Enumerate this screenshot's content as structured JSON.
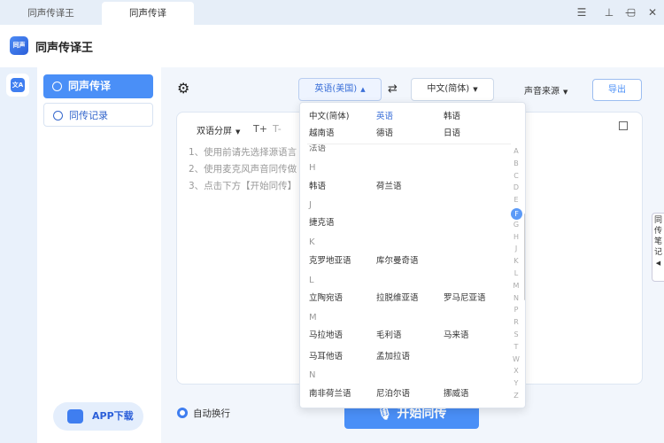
{
  "tabs": [
    "同声传译王",
    "同声传译"
  ],
  "header": {
    "title": "同声传译王",
    "logo_text": "同声"
  },
  "rail": {
    "icon_text": "文A"
  },
  "sidebar": {
    "items": [
      {
        "label": "同声传译"
      },
      {
        "label": "同传记录"
      }
    ],
    "app_download": "APP下载"
  },
  "toolbar": {
    "source_lang": "英语(美国)",
    "target_lang": "中文(简体)",
    "voice_source": "声音来源",
    "export": "导出"
  },
  "card": {
    "mode": "双语分屏",
    "tips": [
      "1、使用前请先选择源语言",
      "2、使用麦克风声音同传做",
      "3、点击下方【开始同传】"
    ],
    "font_up": "T+",
    "font_down": "T-"
  },
  "auto_wrap": "自动换行",
  "start_button": "开始同传",
  "side_tab": "同传笔记",
  "dropdown": {
    "recent_row1": [
      "中文(简体)",
      "英语",
      "韩语"
    ],
    "recent_row2": [
      "越南语",
      "德语",
      "日语"
    ],
    "partial": "法语",
    "groups": [
      {
        "letter": "H",
        "langs": [
          "韩语",
          "荷兰语"
        ]
      },
      {
        "letter": "J",
        "langs": [
          "捷克语"
        ]
      },
      {
        "letter": "K",
        "langs": [
          "克罗地亚语",
          "库尔曼奇语"
        ]
      },
      {
        "letter": "L",
        "langs": [
          "立陶宛语",
          "拉脱维亚语",
          "罗马尼亚语"
        ]
      },
      {
        "letter": "M",
        "langs": [
          "马拉地语",
          "毛利语",
          "马来语",
          "马耳他语",
          "孟加拉语"
        ]
      },
      {
        "letter": "N",
        "langs": [
          "南非荷兰语",
          "尼泊尔语",
          "挪威语"
        ]
      }
    ],
    "alphabet": [
      "A",
      "B",
      "C",
      "D",
      "E",
      "F",
      "G",
      "H",
      "J",
      "K",
      "L",
      "M",
      "N",
      "P",
      "R",
      "S",
      "T",
      "W",
      "X",
      "Y",
      "Z"
    ],
    "active_letter": "F"
  },
  "colors": {
    "accent": "#4a8ff7",
    "sidebar_bg": "#e9f1fb"
  }
}
